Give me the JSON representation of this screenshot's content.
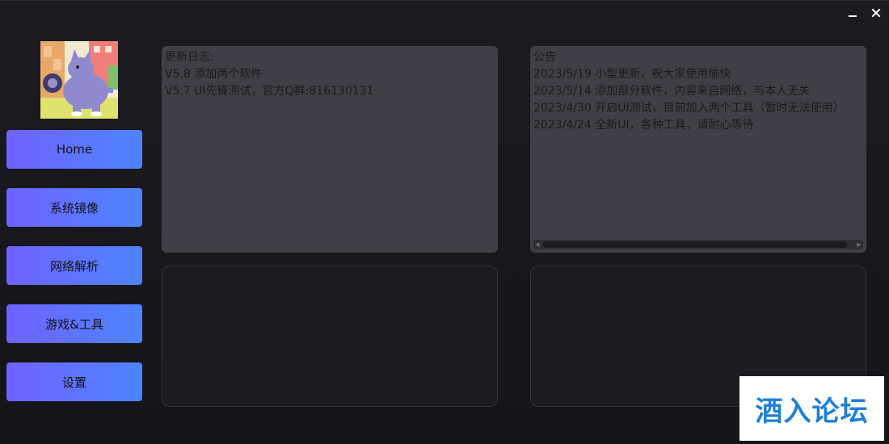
{
  "window": {
    "minimize_glyph": "—",
    "close_glyph": "✕"
  },
  "sidebar": {
    "items": [
      {
        "label": "Home"
      },
      {
        "label": "系统镜像"
      },
      {
        "label": "网络解析"
      },
      {
        "label": "游戏&工具"
      },
      {
        "label": "设置"
      }
    ]
  },
  "changelog": {
    "title": "更新日志:",
    "lines": [
      "V5.8 添加两个软件",
      "V5.7 UI先锋测试，官方Q群:816130131"
    ]
  },
  "announcement": {
    "title": "公告",
    "lines": [
      "2023/5/19 小型更新，祝大家使用愉快",
      "2023/5/14 添加部分软件，内容来自网络，与本人无关",
      "2023/4/30 开启UI测试，目前加入两个工具（暂时无法使用）",
      "2023/4/24 全新UI，各种工具，请耐心等待"
    ]
  },
  "watermark": {
    "text": "酒入论坛"
  },
  "colors": {
    "nav_gradient_start": "#6f62ff",
    "nav_gradient_end": "#4d84ff",
    "panel_bg": "#403f47",
    "window_bg": "#17171c",
    "watermark_text": "#1f7fd8"
  }
}
